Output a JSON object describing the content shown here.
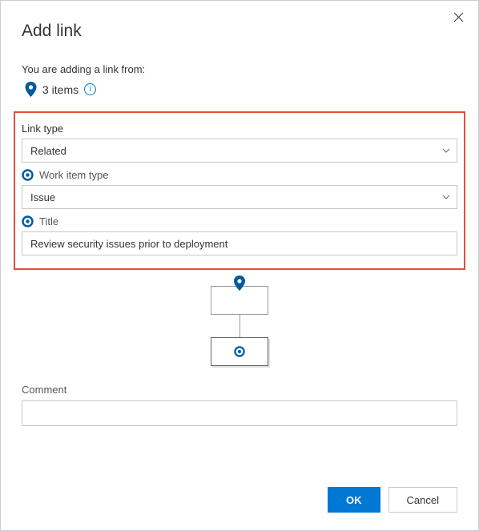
{
  "dialog": {
    "title": "Add link",
    "subheading": "You are adding a link from:",
    "source_count": "3 items"
  },
  "fields": {
    "link_type": {
      "label": "Link type",
      "value": "Related"
    },
    "work_item_type": {
      "label": "Work item type",
      "value": "Issue"
    },
    "title": {
      "label": "Title",
      "value": "Review security issues prior to deployment"
    },
    "comment": {
      "label": "Comment",
      "value": ""
    }
  },
  "buttons": {
    "ok": "OK",
    "cancel": "Cancel"
  },
  "colors": {
    "primary": "#0078d4",
    "highlight_border": "#e64c3c",
    "pin": "#005a9e"
  }
}
